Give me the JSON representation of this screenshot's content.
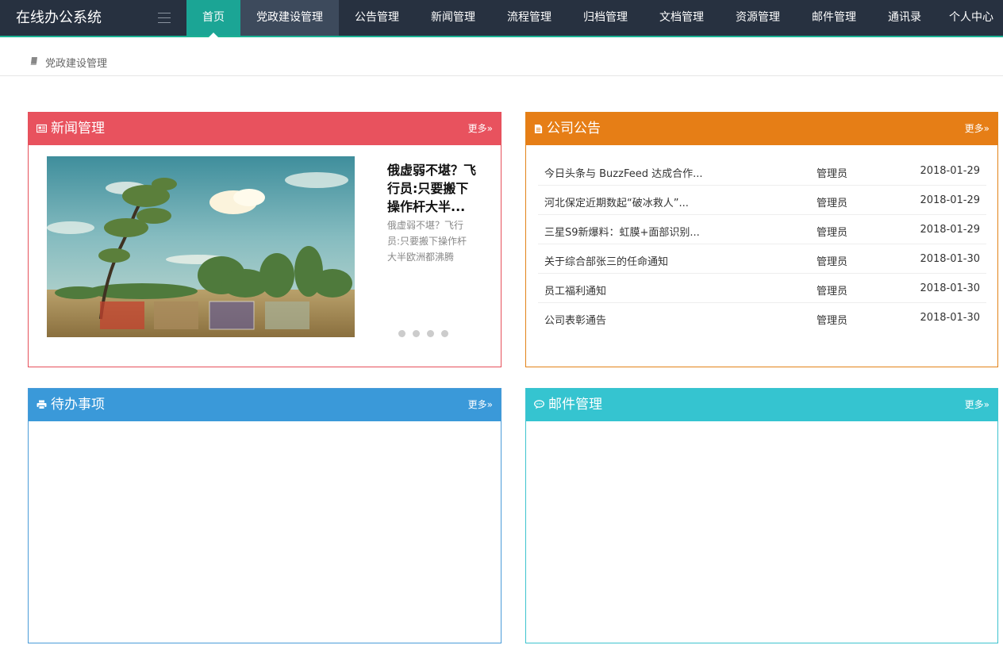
{
  "app": {
    "title": "在线办公系统"
  },
  "nav": {
    "items": [
      {
        "label": "首页"
      },
      {
        "label": "党政建设管理"
      },
      {
        "label": "公告管理"
      },
      {
        "label": "新闻管理"
      },
      {
        "label": "流程管理"
      },
      {
        "label": "归档管理"
      },
      {
        "label": "文档管理"
      },
      {
        "label": "资源管理"
      },
      {
        "label": "邮件管理"
      },
      {
        "label": "通讯录"
      },
      {
        "label": "个人中心"
      }
    ],
    "active": "首页",
    "hovered": "党政建设管理"
  },
  "breadcrumb": {
    "label": "党政建设管理",
    "icon": "book-icon"
  },
  "panels": {
    "news": {
      "title": "新闻管理",
      "more": "更多»",
      "icon": "newspaper-icon",
      "color": "#e8525e",
      "headline": "俄虚弱不堪？飞行员:只要搬下操作杆大半...",
      "summary": "俄虚弱不堪？飞行员:只要搬下操作杆大半欧洲都沸腾",
      "slide_count": 4
    },
    "notice": {
      "title": "公司公告",
      "more": "更多»",
      "icon": "document-icon",
      "color": "#e67e16",
      "rows": [
        {
          "title": "今日头条与 BuzzFeed 达成合作...",
          "author": "管理员",
          "date": "2018-01-29"
        },
        {
          "title": "河北保定近期数起“破冰救人”...",
          "author": "管理员",
          "date": "2018-01-29"
        },
        {
          "title": "三星S9新爆料：虹膜+面部识别...",
          "author": "管理员",
          "date": "2018-01-29"
        },
        {
          "title": "关于综合部张三的任命通知",
          "author": "管理员",
          "date": "2018-01-30"
        },
        {
          "title": "员工福利通知",
          "author": "管理员",
          "date": "2018-01-30"
        },
        {
          "title": "公司表彰通告",
          "author": "管理员",
          "date": "2018-01-30"
        }
      ]
    },
    "todo": {
      "title": "待办事项",
      "more": "更多»",
      "icon": "printer-icon",
      "color": "#3a99d9"
    },
    "mail": {
      "title": "邮件管理",
      "more": "更多»",
      "icon": "chat-icon",
      "color": "#35c4d0"
    }
  }
}
